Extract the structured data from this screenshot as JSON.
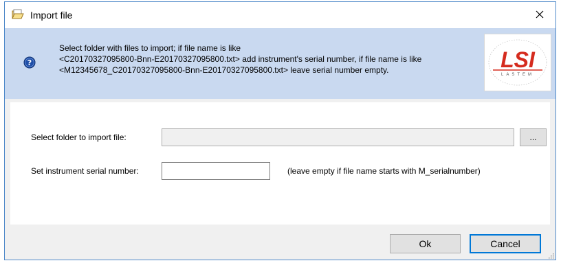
{
  "window": {
    "title": "Import file",
    "icons": {
      "title": "folder-open-icon",
      "close": "close-icon",
      "help": "question-mark-icon",
      "grip": "resize-grip-icon"
    }
  },
  "header": {
    "lines": [
      "Select folder with files to import; if file name is like",
      "<C20170327095800-Bnn-E20170327095800.txt> add instrument's serial number, if file name is like",
      "<M12345678_C20170327095800-Bnn-E20170327095800.txt> leave serial number empty."
    ],
    "logo": {
      "text": "LSI",
      "subtext": "LASTEM",
      "color": "#d52b1e"
    }
  },
  "form": {
    "folder_label": "Select folder to import file:",
    "folder_value": "",
    "browse_label": "...",
    "serial_label": "Set instrument serial number:",
    "serial_value": "",
    "serial_hint": "(leave empty if file name starts with M_serialnumber)"
  },
  "buttons": {
    "ok": "Ok",
    "cancel": "Cancel"
  },
  "colors": {
    "header_band": "#c9d9f0",
    "window_border": "#4a86c8",
    "focus": "#0078d7",
    "help_icon": "#1f4fa8"
  }
}
